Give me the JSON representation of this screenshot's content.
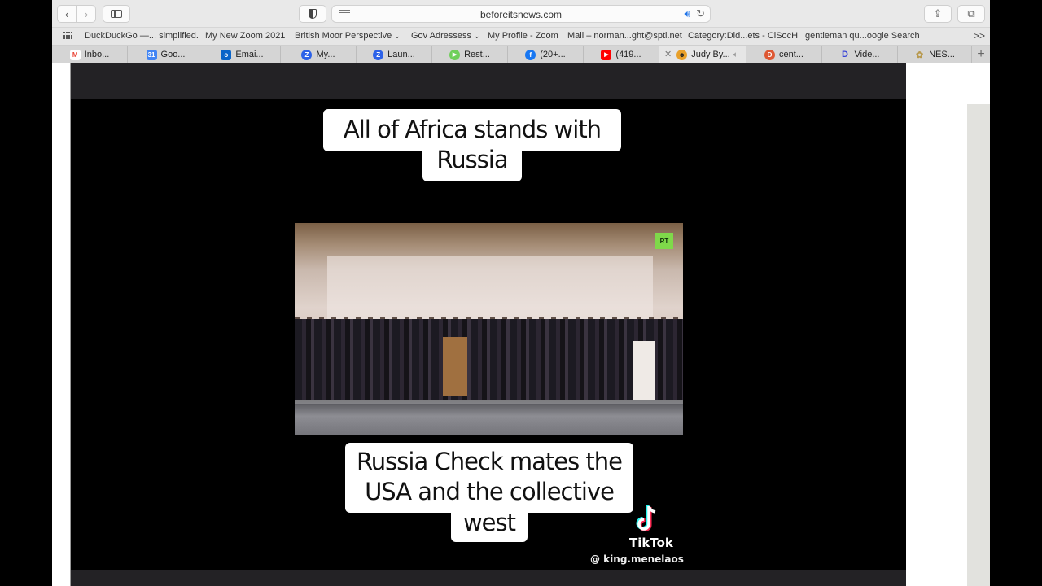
{
  "browser": {
    "url": "beforeitsnews.com",
    "bookmarks": [
      {
        "label": "DuckDuckGo —... simplified.",
        "has_menu": false
      },
      {
        "label": "My New Zoom 2021",
        "has_menu": false
      },
      {
        "label": "British Moor Perspective",
        "has_menu": true
      },
      {
        "label": "Gov Adressess",
        "has_menu": true
      },
      {
        "label": "My Profile - Zoom",
        "has_menu": false
      },
      {
        "label": "Mail – norman...ght@spti.net",
        "has_menu": false
      },
      {
        "label": "Category:Did...ets - CiSocH",
        "has_menu": false
      },
      {
        "label": "gentleman qu...oogle Search",
        "has_menu": false
      }
    ],
    "bookmarks_more": ">>",
    "tabs": [
      {
        "label": "Inbo...",
        "icon": "gmail-icon",
        "color": "#ea4335",
        "glyph": "M"
      },
      {
        "label": "Goo...",
        "icon": "google-calendar-icon",
        "color": "#4285f4",
        "glyph": "31"
      },
      {
        "label": "Emai...",
        "icon": "outlook-icon",
        "color": "#0a64c8",
        "glyph": "o"
      },
      {
        "label": "My...",
        "icon": "zoom-icon",
        "color": "#2d62e8",
        "glyph": "Z"
      },
      {
        "label": "Laun...",
        "icon": "zoom-icon",
        "color": "#2d62e8",
        "glyph": "Z"
      },
      {
        "label": "Rest...",
        "icon": "rumble-icon",
        "color": "#6fcf5a",
        "glyph": "▶"
      },
      {
        "label": "(20+...",
        "icon": "facebook-icon",
        "color": "#1877f2",
        "glyph": "f"
      },
      {
        "label": "(419...",
        "icon": "youtube-icon",
        "color": "#ff0000",
        "glyph": "▶"
      },
      {
        "label": "Judy By...",
        "icon": "site-icon",
        "color": "#e8a02a",
        "glyph": "☻",
        "active": true,
        "audio": true
      },
      {
        "label": "cent...",
        "icon": "duckduckgo-icon",
        "color": "#de5833",
        "glyph": "D"
      },
      {
        "label": "Vide...",
        "icon": "disney-icon",
        "color": "#ffffff",
        "glyph": "D"
      },
      {
        "label": "NES...",
        "icon": "site-icon",
        "color": "#c9b27a",
        "glyph": "✿"
      }
    ]
  },
  "video": {
    "caption_top": [
      "All of Africa stands with",
      "Russia"
    ],
    "caption_bottom": [
      "Russia Check mates the",
      "USA and the collective",
      "west"
    ],
    "watermark_channel": "RT",
    "tiktok_brand": "TikTok",
    "tiktok_handle": "@ king.menelaos"
  }
}
